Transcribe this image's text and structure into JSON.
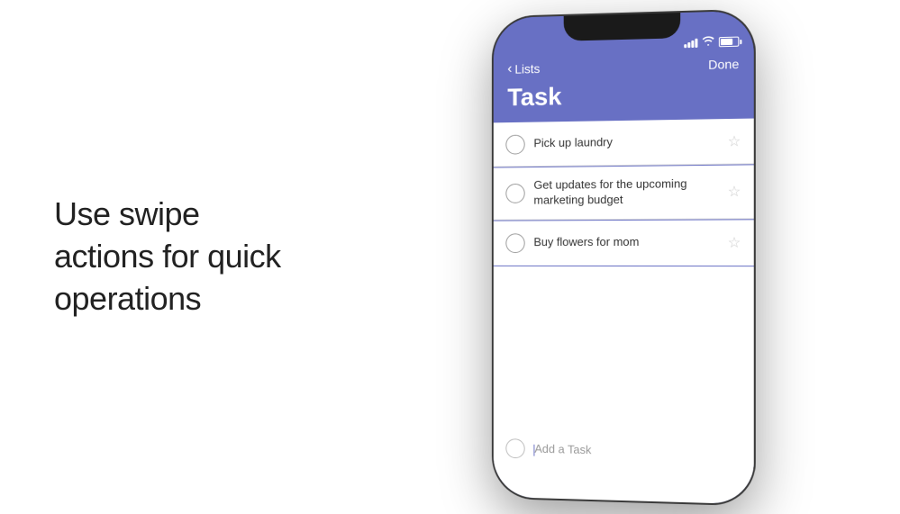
{
  "left": {
    "tagline": "Use swipe actions for quick operations"
  },
  "phone": {
    "statusBar": {
      "timeHidden": true
    },
    "navBar": {
      "backLabel": "Lists",
      "doneLabel": "Done"
    },
    "pageTitle": "Task",
    "tasks": [
      {
        "id": 1,
        "text": "Pick up laundry",
        "starred": false
      },
      {
        "id": 2,
        "text": "Get updates for the upcoming marketing budget",
        "starred": false
      },
      {
        "id": 3,
        "text": "Buy flowers for mom",
        "starred": false
      }
    ],
    "addTaskPlaceholder": "Add a Task",
    "colors": {
      "accent": "#6870c4"
    }
  }
}
